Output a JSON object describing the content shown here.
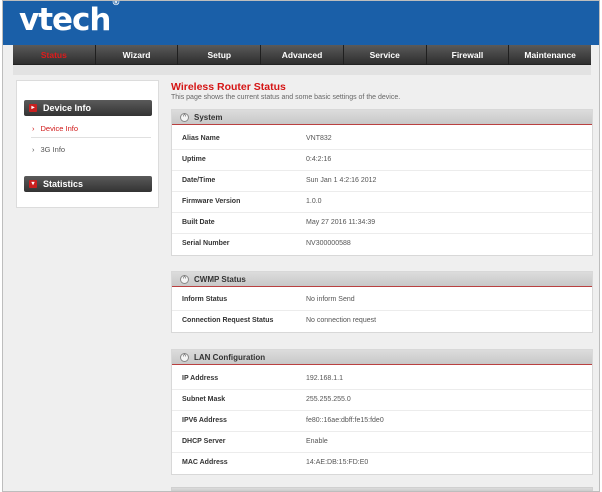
{
  "brand": {
    "logo_text": "vtech",
    "trademark": "®"
  },
  "nav": {
    "items": [
      {
        "label": "Status",
        "active": true
      },
      {
        "label": "Wizard"
      },
      {
        "label": "Setup"
      },
      {
        "label": "Advanced"
      },
      {
        "label": "Service"
      },
      {
        "label": "Firewall"
      },
      {
        "label": "Maintenance"
      }
    ]
  },
  "sidebar": {
    "device_info_header": "Device Info",
    "links": [
      {
        "label": "Device Info",
        "active": true
      },
      {
        "label": "3G Info"
      }
    ],
    "statistics_header": "Statistics"
  },
  "main": {
    "title": "Wireless Router Status",
    "description": "This page shows the current status and some basic settings of the device."
  },
  "panels": {
    "system": {
      "header": "System",
      "rows": [
        {
          "label": "Alias Name",
          "value": "VNT832"
        },
        {
          "label": "Uptime",
          "value": "0:4:2:16"
        },
        {
          "label": "Date/Time",
          "value": "Sun Jan 1 4:2:16 2012"
        },
        {
          "label": "Firmware Version",
          "value": "1.0.0"
        },
        {
          "label": "Built Date",
          "value": "May 27 2016 11:34:39"
        },
        {
          "label": "Serial Number",
          "value": "NV300000588"
        }
      ]
    },
    "cwmp": {
      "header": "CWMP Status",
      "rows": [
        {
          "label": "Inform Status",
          "value": "No inform Send"
        },
        {
          "label": "Connection Request Status",
          "value": "No connection request"
        }
      ]
    },
    "lan": {
      "header": "LAN Configuration",
      "rows": [
        {
          "label": "IP Address",
          "value": "192.168.1.1"
        },
        {
          "label": "Subnet Mask",
          "value": "255.255.255.0"
        },
        {
          "label": "IPV6 Address",
          "value": "fe80::16ae:dbff:fe15:fde0"
        },
        {
          "label": "DHCP Server",
          "value": "Enable"
        },
        {
          "label": "MAC Address",
          "value": "14:AE:DB:15:FD:E0"
        }
      ]
    }
  },
  "colors": {
    "brand_blue": "#1a5fa8",
    "accent_red": "#d51515",
    "nav_dark": "#3a3a3a"
  },
  "icons": {
    "collapse": "collapse-circle-icon",
    "bullet": "red-square-bullet-icon",
    "chevron": "chevron-right-icon"
  }
}
